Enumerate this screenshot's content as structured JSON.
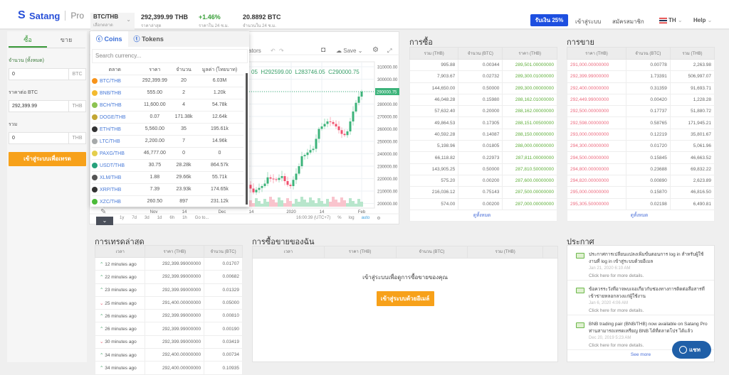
{
  "header": {
    "brand": "Satang",
    "product": "Pro",
    "market": "BTC/THB",
    "market_label": "เลือกตลาด",
    "last_price": "292,399.99 THB",
    "last_price_label": "ราคาล่าสุด",
    "change": "+1.46%",
    "change_label": "ราคาใน 24 ช.ม.",
    "volume": "20.8892 BTC",
    "volume_label": "จำนวนใน 24 ช.ม.",
    "promo": "รับเงิน 25%",
    "login": "เข้าสู่ระบบ",
    "signup": "สมัครสมาชิก",
    "lang": "TH",
    "help": "Help"
  },
  "order_form": {
    "buy_tab": "ซื้อ",
    "sell_tab": "ขาย",
    "amount_label": "จำนวน (ทั้งหมด)",
    "amount": "0",
    "amount_unit": "BTC",
    "price_label": "ราคาต่อ BTC",
    "price": "292,399.99",
    "price_unit": "THB",
    "total_label": "รวม",
    "total": "0",
    "total_unit": "THB",
    "submit": "เข้าสู่ระบบเพื่อเทรด"
  },
  "market_dropdown": {
    "tab_coins": "Coins",
    "tab_tokens": "Tokens",
    "search_placeholder": "Search currency...",
    "columns": [
      "ตลาด",
      "ราคา",
      "จำนวน",
      "มูลค่า (ไทยบาท)"
    ],
    "rows": [
      [
        "BTC/THB",
        "292,399.99",
        "20",
        "6.03M",
        "#f7931a"
      ],
      [
        "BNB/THB",
        "555.00",
        "2",
        "1.20k",
        "#f3ba2f"
      ],
      [
        "BCH/THB",
        "11,600.00",
        "4",
        "54.78k",
        "#8dc351"
      ],
      [
        "DOGE/THB",
        "0.07",
        "171.38k",
        "12.64k",
        "#c2a633"
      ],
      [
        "ETH/THB",
        "5,560.00",
        "35",
        "195.61k",
        "#333333"
      ],
      [
        "LTC/THB",
        "2,200.00",
        "7",
        "14.96k",
        "#a6a9aa"
      ],
      [
        "PAXG/THB",
        "46,777.00",
        "0",
        "0",
        "#e4ce4d"
      ],
      [
        "USDT/THB",
        "30.75",
        "28.28k",
        "864.57k",
        "#26a17b"
      ],
      [
        "XLM/THB",
        "1.88",
        "29.66k",
        "55.71k",
        "#555555"
      ],
      [
        "XRP/THB",
        "7.39",
        "23.93k",
        "174.65k",
        "#333333"
      ],
      [
        "XZC/THB",
        "260.50",
        "897",
        "231.12k",
        "#4cbb3a"
      ]
    ]
  },
  "chart": {
    "indicators": "ators",
    "save": "Save",
    "ohlc_o": "05",
    "ohlc_h": "H292599.00",
    "ohlc_l": "L283746.05",
    "ohlc_c": "C290000.75",
    "last_label": "290000.75",
    "time": "16:00:39 (UTC+7)",
    "pct": "%",
    "log": "log",
    "auto": "auto",
    "goto": "Go to...",
    "ranges": [
      "1y",
      "7d",
      "3d",
      "1d",
      "6h",
      "1h"
    ],
    "x_ticks": [
      "Nov",
      "14",
      "Dec",
      "14",
      "2020",
      "14",
      "Feb"
    ],
    "chart_data": {
      "type": "candlestick",
      "y_ticks": [
        310000,
        300000,
        290000,
        280000,
        270000,
        260000,
        250000,
        240000,
        230000,
        220000,
        210000,
        200000
      ],
      "last": 290000.75,
      "closes": [
        255000,
        258000,
        252000,
        250000,
        247000,
        245000,
        248000,
        243000,
        240000,
        238000,
        236000,
        240000,
        237000,
        233000,
        230000,
        228000,
        231000,
        229000,
        226000,
        224000,
        222000,
        225000,
        223000,
        221000,
        219000,
        218000,
        220000,
        217000,
        216000,
        218000,
        215000,
        213000,
        214000,
        216000,
        215000,
        217000,
        219000,
        218000,
        216000,
        217000,
        219000,
        216000,
        214000,
        218000,
        220000,
        217000,
        215000,
        213000,
        216000,
        217000,
        215000,
        212000,
        209000,
        211000,
        212500,
        214000,
        216000,
        221000,
        220000,
        219500,
        219000,
        220500,
        222000,
        218000,
        215000,
        214000,
        219000,
        224000,
        230000,
        238000,
        239000,
        241000,
        243000,
        244000,
        252000,
        260000,
        262000,
        264000,
        266000,
        265500,
        264000,
        262000,
        259000,
        256000,
        255000,
        258000,
        266000,
        274000,
        281000,
        286000,
        290000
      ]
    }
  },
  "bids": {
    "title": "การซื้อ",
    "columns": [
      "รวม (THB)",
      "จำนวน (BTC)",
      "ราคา (THB)"
    ],
    "see_all": "ดูทั้งหมด",
    "rows": [
      [
        "995.88",
        "0.00344",
        "289,501.00000000"
      ],
      [
        "7,903.67",
        "0.02732",
        "289,300.01000000"
      ],
      [
        "144,650.00",
        "0.50000",
        "289,300.00000000"
      ],
      [
        "46,048.28",
        "0.15980",
        "288,162.01000000"
      ],
      [
        "57,632.40",
        "0.20000",
        "288,162.00000000"
      ],
      [
        "49,864.53",
        "0.17305",
        "288,151.00500000"
      ],
      [
        "40,592.28",
        "0.14087",
        "288,150.00000000"
      ],
      [
        "5,198.96",
        "0.01805",
        "288,000.00000000"
      ],
      [
        "66,118.82",
        "0.22973",
        "287,811.00000000"
      ],
      [
        "143,905.25",
        "0.50000",
        "287,810.50000000"
      ],
      [
        "575.20",
        "0.00200",
        "287,600.00000000"
      ],
      [
        "216,036.12",
        "0.75143",
        "287,500.00000000"
      ],
      [
        "574.00",
        "0.00200",
        "287,000.00000000"
      ]
    ]
  },
  "asks": {
    "title": "การขาย",
    "columns": [
      "ราคา (THB)",
      "จำนวน (BTC)",
      "รวม (THB)"
    ],
    "see_all": "ดูทั้งหมด",
    "rows": [
      [
        "291,000.00000000",
        "0.00778",
        "2,263.98"
      ],
      [
        "292,399.99000000",
        "1.73391",
        "506,997.07"
      ],
      [
        "292,400.00000000",
        "0.31359",
        "91,693.71"
      ],
      [
        "292,449.99000000",
        "0.00420",
        "1,228.28"
      ],
      [
        "292,500.00000000",
        "0.17737",
        "51,880.72"
      ],
      [
        "292,598.00000000",
        "0.58765",
        "171,945.21"
      ],
      [
        "293,000.00000000",
        "0.12219",
        "35,801.67"
      ],
      [
        "294,300.00000000",
        "0.01720",
        "5,061.96"
      ],
      [
        "294,500.00000000",
        "0.15845",
        "46,663.52"
      ],
      [
        "294,800.00000000",
        "0.23688",
        "69,832.22"
      ],
      [
        "294,820.00000000",
        "0.00890",
        "2,623.89"
      ],
      [
        "295,000.00000000",
        "0.15870",
        "46,816.50"
      ],
      [
        "295,305.50000000",
        "0.02198",
        "6,490.81"
      ]
    ]
  },
  "trades": {
    "title": "การเทรดล่าสุด",
    "columns": [
      "เวลา",
      "ราคา (THB)",
      "จำนวน (BTC)"
    ],
    "rows": [
      [
        "up",
        "12 minutes ago",
        "292,399.99000000",
        "0.01707"
      ],
      [
        "up",
        "22 minutes ago",
        "292,399.99000000",
        "0.00682"
      ],
      [
        "up",
        "23 minutes ago",
        "292,399.99000000",
        "0.01329"
      ],
      [
        "down",
        "25 minutes ago",
        "291,400.00000000",
        "0.05000"
      ],
      [
        "up",
        "26 minutes ago",
        "292,399.99000000",
        "0.00810"
      ],
      [
        "up",
        "26 minutes ago",
        "292,399.99000000",
        "0.00190"
      ],
      [
        "down",
        "30 minutes ago",
        "292,399.99000000",
        "0.03419"
      ],
      [
        "up",
        "34 minutes ago",
        "292,400.00000000",
        "0.00734"
      ],
      [
        "up",
        "34 minutes ago",
        "292,400.00000000",
        "0.10935"
      ]
    ]
  },
  "my_orders": {
    "title": "การซื้อขายของฉัน",
    "columns": [
      "เวลา",
      "ราคา (THB)",
      "จำนวน (BTC)",
      "รวม (THB)"
    ],
    "message": "เข้าสู่ระบบเพื่อดูการซื้อขายของคุณ",
    "login_email": "เข้าสู่ระบบด้วยอีเมล์"
  },
  "announcements": {
    "title": "ประกาศ",
    "see_more": "See more",
    "items": [
      {
        "text": "ประกาศการเปลี่ยนแปลงเพิ่มขั้นตอนการ log in สำหรับผู้ใช้งานที่ log in เข้าสู่ระบบด้วยอีเมล",
        "date": "Jan 21, 2020 6:10 AM",
        "more": "Click here for more details."
      },
      {
        "text": "ข้อควรระวังที่อาจพบเจอเกี่ยวกับช่องทางการติดต่อสื่อสารที่เข้าข่ายหลอกลวงแก่ผู้ใช้งาน",
        "date": "Jan 6, 2020 4:06 AM",
        "more": "Click here for more details."
      },
      {
        "text": "BNB trading pair (BNB/THB) now available on Satang Pro ท่านสามารถเทรดเหรียญ BNB ได้ที่ตลาดโปร ได้แล้ว",
        "date": "Dec 20, 2019 5:23 AM",
        "more": "Click here for more details."
      }
    ]
  },
  "chat": "แชท"
}
